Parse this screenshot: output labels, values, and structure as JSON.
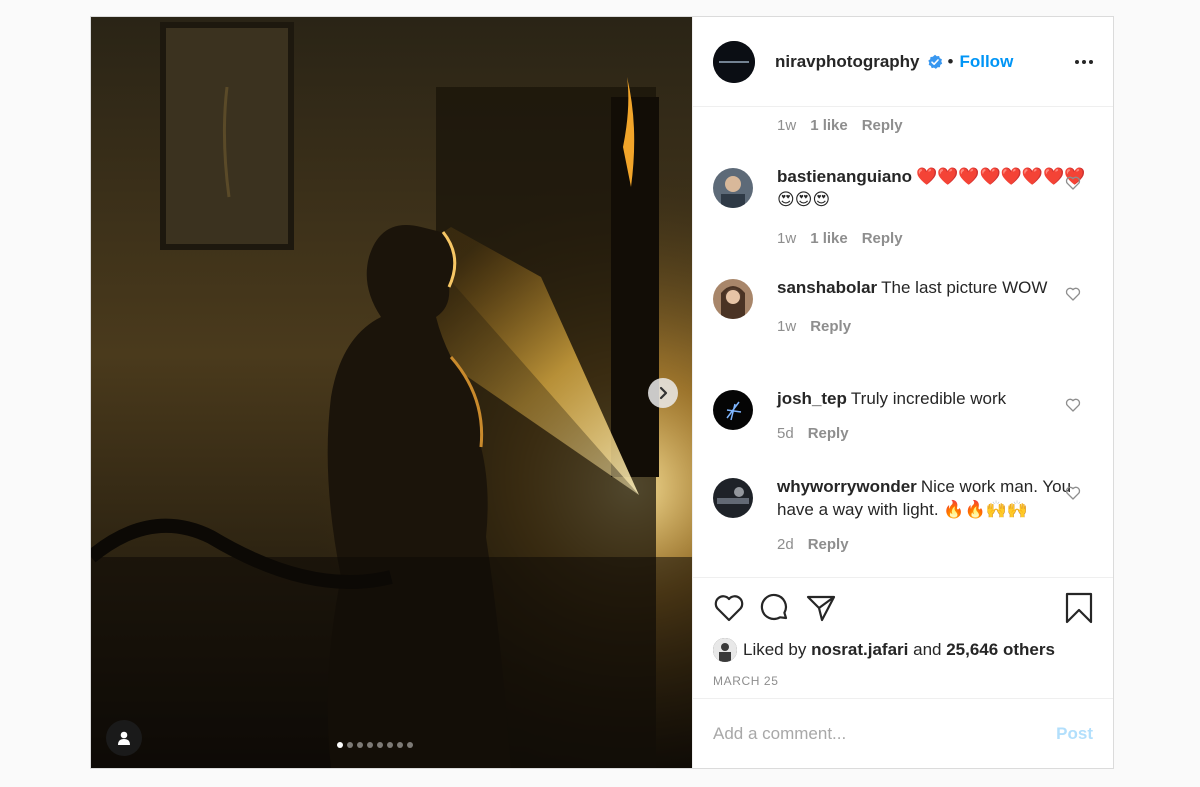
{
  "post": {
    "author": "niravphotography",
    "separator": "•",
    "follow_label": "Follow",
    "image_alt": "Woman standing in a dark room lit by a beam of golden light",
    "carousel": {
      "count": 8,
      "active_index": 0
    }
  },
  "comments": {
    "first_meta": {
      "time": "1w",
      "likes": "1 like",
      "reply": "Reply"
    },
    "items": [
      {
        "user": "bastienanguiano",
        "text": "❤️❤️❤️❤️❤️❤️❤️❤️😍😍😍",
        "time": "1w",
        "likes": "1 like",
        "reply": "Reply"
      },
      {
        "user": "sanshabolar",
        "text": "The last picture WOW",
        "time": "1w",
        "likes": "",
        "reply": "Reply"
      },
      {
        "user": "josh_tep",
        "text": "Truly incredible work",
        "time": "5d",
        "likes": "",
        "reply": "Reply"
      },
      {
        "user": "whyworrywonder",
        "text": "Nice work man. You have a way with light. 🔥🔥🙌🙌",
        "time": "2d",
        "likes": "",
        "reply": "Reply"
      }
    ]
  },
  "likes": {
    "prefix": "Liked by",
    "user": "nosrat.jafari",
    "conjunction": "and",
    "others": "25,646 others"
  },
  "date": "MARCH 25",
  "add_comment": {
    "placeholder": "Add a comment...",
    "post_label": "Post"
  },
  "colors": {
    "accent": "#0095f6",
    "post_disabled": "#b2dffc",
    "muted": "#8e8e8e"
  }
}
